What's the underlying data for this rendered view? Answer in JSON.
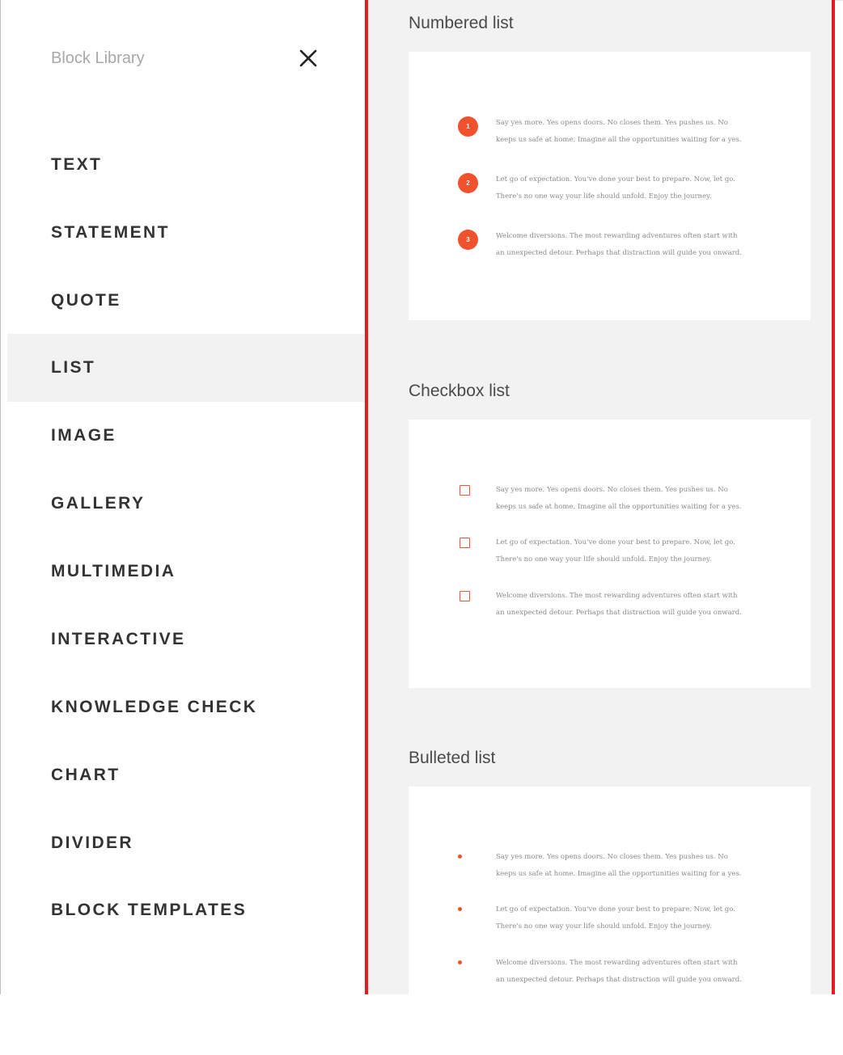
{
  "sidebar": {
    "title": "Block Library",
    "close_icon": "close-icon",
    "items": [
      {
        "label": "TEXT",
        "active": false
      },
      {
        "label": "STATEMENT",
        "active": false
      },
      {
        "label": "QUOTE",
        "active": false
      },
      {
        "label": "LIST",
        "active": true
      },
      {
        "label": "IMAGE",
        "active": false
      },
      {
        "label": "GALLERY",
        "active": false
      },
      {
        "label": "MULTIMEDIA",
        "active": false
      },
      {
        "label": "INTERACTIVE",
        "active": false
      },
      {
        "label": "KNOWLEDGE CHECK",
        "active": false
      },
      {
        "label": "CHART",
        "active": false
      },
      {
        "label": "DIVIDER",
        "active": false
      },
      {
        "label": "BLOCK TEMPLATES",
        "active": false
      }
    ]
  },
  "preview": {
    "sections": [
      {
        "title": "Numbered list",
        "marker": "number",
        "items": [
          {
            "marker": "1",
            "line1": "Say yes more. Yes opens doors. No closes them. Yes pushes us. No",
            "line2": "keeps us safe at home. Imagine all the opportunities waiting for a yes."
          },
          {
            "marker": "2",
            "line1": "Let go of expectation. You've done your best to prepare. Now, let go.",
            "line2": "There's no one way your life should unfold. Enjoy the journey."
          },
          {
            "marker": "3",
            "line1": "Welcome diversions. The most rewarding adventures often start with",
            "line2": "an unexpected detour. Perhaps that distraction will guide you onward."
          }
        ]
      },
      {
        "title": "Checkbox list",
        "marker": "checkbox",
        "items": [
          {
            "line1": "Say yes more. Yes opens doors. No closes them. Yes pushes us. No",
            "line2": "keeps us safe at home. Imagine all the opportunities waiting for a yes."
          },
          {
            "line1": "Let go of expectation. You've done your best to prepare. Now, let go.",
            "line2": "There's no one way your life should unfold. Enjoy the journey."
          },
          {
            "line1": "Welcome diversions. The most rewarding adventures often start with",
            "line2": "an unexpected detour. Perhaps that distraction will guide you onward."
          }
        ]
      },
      {
        "title": "Bulleted list",
        "marker": "bullet",
        "items": [
          {
            "line1": "Say yes more. Yes opens doors. No closes them. Yes pushes us. No",
            "line2": "keeps us safe at home. Imagine all the opportunities waiting for a yes."
          },
          {
            "line1": "Let go of expectation. You've done your best to prepare. Now, let go.",
            "line2": "There's no one way your life should unfold. Enjoy the journey."
          },
          {
            "line1": "Welcome diversions. The most rewarding adventures often start with",
            "line2": "an unexpected detour. Perhaps that distraction will guide you onward."
          }
        ]
      }
    ]
  },
  "colors": {
    "accent": "#f0522d",
    "highlight_border": "#e41e1e",
    "preview_bg": "#f2f2f2",
    "active_item_bg": "#f2f2f2"
  }
}
